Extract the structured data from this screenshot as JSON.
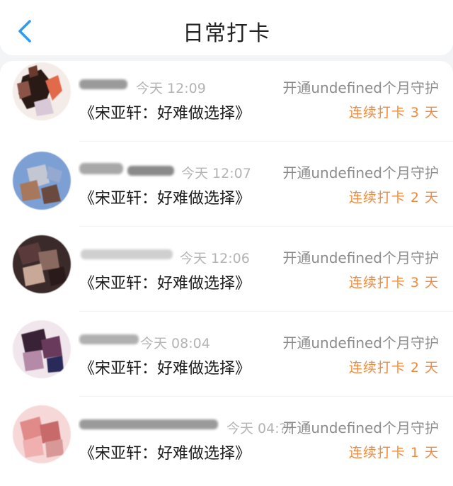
{
  "header": {
    "title": "日常打卡",
    "back_icon": "chevron-left-icon",
    "accent_color": "#2e9bf0"
  },
  "entries": [
    {
      "time": "今天 12:09",
      "guard": "开通undefined个月守护",
      "book": "《宋亚轩：好难做选择》",
      "streak": "连续打卡 3 天"
    },
    {
      "time": "今天 12:07",
      "guard": "开通undefined个月守护",
      "book": "《宋亚轩：好难做选择》",
      "streak": "连续打卡 2 天"
    },
    {
      "time": "今天 12:06",
      "guard": "开通undefined个月守护",
      "book": "《宋亚轩：好难做选择》",
      "streak": "连续打卡 3 天"
    },
    {
      "time": "今天 08:04",
      "guard": "开通undefined个月守护",
      "book": "《宋亚轩：好难做选择》",
      "streak": "连续打卡 2 天"
    },
    {
      "time": "今天 04:??",
      "guard": "开通undefined个月守护",
      "book": "《宋亚轩：好难做选择》",
      "streak": "连续打卡 1 天"
    }
  ],
  "colors": {
    "streak": "#f08a3c",
    "guard_text": "#8c8c8c",
    "time_text": "#b4b4b4"
  }
}
